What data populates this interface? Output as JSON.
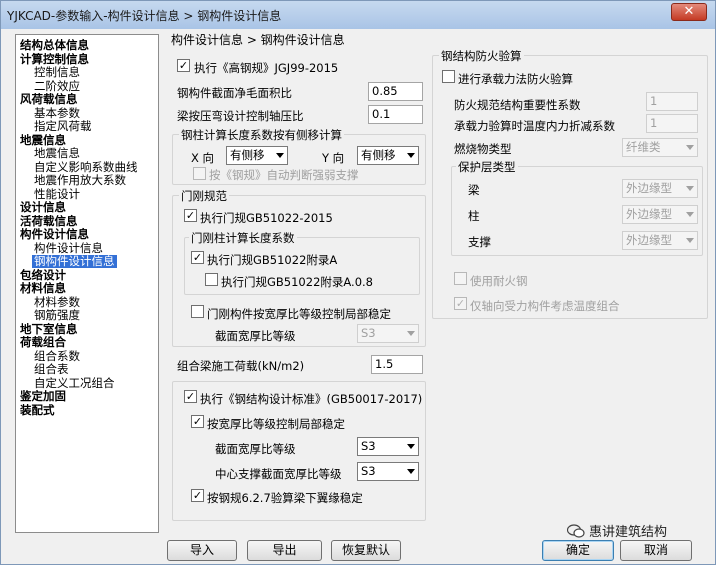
{
  "window": {
    "title": "YJKCAD-参数输入-构件设计信息 > 钢构件设计信息",
    "close_label": "✕"
  },
  "breadcrumb": "构件设计信息 > 钢构件设计信息",
  "tree": [
    {
      "label": "结构总体信息",
      "level": 0
    },
    {
      "label": "计算控制信息",
      "level": 0
    },
    {
      "label": "控制信息",
      "level": 1
    },
    {
      "label": "二阶效应",
      "level": 1
    },
    {
      "label": "风荷载信息",
      "level": 0
    },
    {
      "label": "基本参数",
      "level": 1
    },
    {
      "label": "指定风荷载",
      "level": 1
    },
    {
      "label": "地震信息",
      "level": 0
    },
    {
      "label": "地震信息",
      "level": 1
    },
    {
      "label": "自定义影响系数曲线",
      "level": 1
    },
    {
      "label": "地震作用放大系数",
      "level": 1
    },
    {
      "label": "性能设计",
      "level": 1
    },
    {
      "label": "设计信息",
      "level": 0
    },
    {
      "label": "活荷载信息",
      "level": 0
    },
    {
      "label": "构件设计信息",
      "level": 0
    },
    {
      "label": "构件设计信息",
      "level": 1
    },
    {
      "label": "钢构件设计信息",
      "level": 1,
      "selected": true
    },
    {
      "label": "包络设计",
      "level": 0
    },
    {
      "label": "材料信息",
      "level": 0
    },
    {
      "label": "材料参数",
      "level": 1
    },
    {
      "label": "钢筋强度",
      "level": 1
    },
    {
      "label": "地下室信息",
      "level": 0
    },
    {
      "label": "荷载组合",
      "level": 0
    },
    {
      "label": "组合系数",
      "level": 1
    },
    {
      "label": "组合表",
      "level": 1
    },
    {
      "label": "自定义工况组合",
      "level": 1
    },
    {
      "label": "鉴定加固",
      "level": 0
    },
    {
      "label": "装配式",
      "level": 0
    }
  ],
  "left": {
    "exec_gaogang": {
      "label": "执行《高钢规》JGJ99-2015",
      "checked": true
    },
    "net_area_ratio": {
      "label": "钢构件截面净毛面积比",
      "value": "0.85"
    },
    "beam_axial_ratio": {
      "label": "梁按压弯设计控制轴压比",
      "value": "0.1"
    },
    "column_length": {
      "legend": "钢柱计算长度系数按有侧移计算",
      "x_label": "X 向",
      "x_value": "有侧移",
      "y_label": "Y 向",
      "y_value": "有侧移",
      "auto_label": "按《钢规》自动判断强弱支撑",
      "auto_checked": false
    },
    "portal": {
      "legend": "门刚规范",
      "exec_label": "执行门规GB51022-2015",
      "exec_checked": true,
      "sub_legend": "门刚柱计算长度系数",
      "appA_label": "执行门规GB51022附录A",
      "appA_checked": true,
      "appA08_label": "执行门规GB51022附录A.0.8",
      "appA08_checked": false,
      "local_label": "门刚构件按宽厚比等级控制局部稳定",
      "local_checked": false,
      "grade_label": "截面宽厚比等级",
      "grade_value": "S3"
    },
    "construction_load": {
      "label": "组合梁施工荷载(kN/m2)",
      "value": "1.5"
    },
    "steel_std": {
      "exec_label": "执行《钢结构设计标准》(GB50017-2017)",
      "exec_checked": true,
      "local_label": "按宽厚比等级控制局部稳定",
      "local_checked": true,
      "grade_label": "截面宽厚比等级",
      "grade_value": "S3",
      "brace_label": "中心支撑截面宽厚比等级",
      "brace_value": "S3",
      "clause_label": "按钢规6.2.7验算梁下翼缘稳定",
      "clause_checked": true
    }
  },
  "fire": {
    "legend": "钢结构防火验算",
    "bearing_label": "进行承载力法防火验算",
    "bearing_checked": false,
    "importance_label": "防火规范结构重要性系数",
    "importance_value": "1",
    "reduction_label": "承载力验算时温度内力折减系数",
    "reduction_value": "1",
    "fuel_label": "燃烧物类型",
    "fuel_value": "纤维类",
    "protect_legend": "保护层类型",
    "beam_label": "梁",
    "beam_value": "外边缘型",
    "column_label": "柱",
    "column_value": "外边缘型",
    "brace_label": "支撑",
    "brace_value": "外边缘型",
    "fire_steel_label": "使用耐火钢",
    "fire_steel_checked": false,
    "axial_label": "仅轴向受力构件考虑温度组合",
    "axial_checked": true
  },
  "buttons": {
    "import": "导入",
    "export": "导出",
    "restore": "恢复默认",
    "ok": "确定",
    "cancel": "取消"
  },
  "watermark": "惠讲建筑结构"
}
